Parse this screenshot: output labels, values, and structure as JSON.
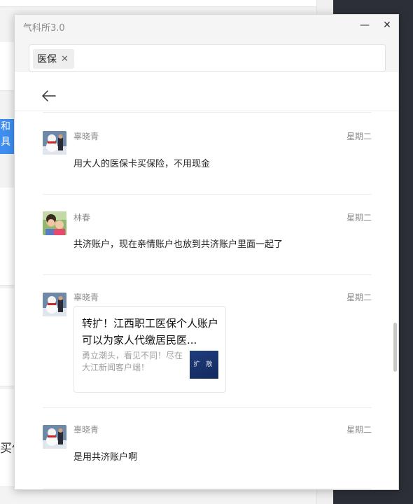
{
  "window": {
    "title": "气科所3.0",
    "minimize_glyph": "—",
    "close_glyph": "✕"
  },
  "search": {
    "chip_label": "医保",
    "chip_close_glyph": "✕"
  },
  "background": {
    "fragment_text": "买保",
    "blue_text": "和 具"
  },
  "messages": [
    {
      "sender": "辜晓青",
      "time": "星期二",
      "type": "text",
      "text": "用大人的医保卡买保险，不用现金",
      "avatar": "snowman-avatar"
    },
    {
      "sender": "林春",
      "time": "星期二",
      "type": "text",
      "text": "共济账户，现在亲情账户也放到共济账户里面一起了",
      "avatar": "family-photo-avatar"
    },
    {
      "sender": "辜晓青",
      "time": "星期二",
      "type": "link",
      "card": {
        "title": "转扩！江西职工医保个人账户可以为家人代缴居民医...",
        "desc": "勇立潮头，看见不同！尽在大江新闻客户端！",
        "thumb_text": "扩 散"
      },
      "avatar": "snowman-avatar"
    },
    {
      "sender": "辜晓青",
      "time": "星期二",
      "type": "text",
      "text": "是用共济账户啊",
      "avatar": "snowman-avatar"
    }
  ],
  "colors": {
    "accent_blue": "#3d8ef0",
    "dark_panel": "#2c2f36",
    "thumb_blue": "#1f3c7c"
  }
}
